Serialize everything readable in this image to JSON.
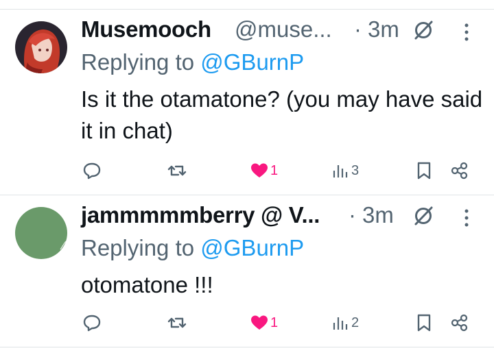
{
  "tweets": [
    {
      "display_name": "Musemooch",
      "handle": "@muse...",
      "dot": "·",
      "time": "3m",
      "reply_prefix": "Replying to ",
      "reply_to": "@GBurnP",
      "text": "Is it the otamatone? (you may have said it in chat)",
      "likes": "1",
      "views": "3",
      "liked": true,
      "avatar": "red-haired-anime-avatar"
    },
    {
      "display_name": "jammmmmberry @ V...",
      "handle": "",
      "dot": "·",
      "time": "3m",
      "reply_prefix": "Replying to ",
      "reply_to": "@GBurnP",
      "text": "otomatone !!!",
      "likes": "1",
      "views": "2",
      "liked": true,
      "avatar": "green-circle-avatar"
    }
  ],
  "colors": {
    "text": "#0f1419",
    "secondary": "#536471",
    "mention": "#1d9bf0",
    "like": "#f91880",
    "divider": "#dfe3e6",
    "avatar_green": "#6a9a6a"
  }
}
